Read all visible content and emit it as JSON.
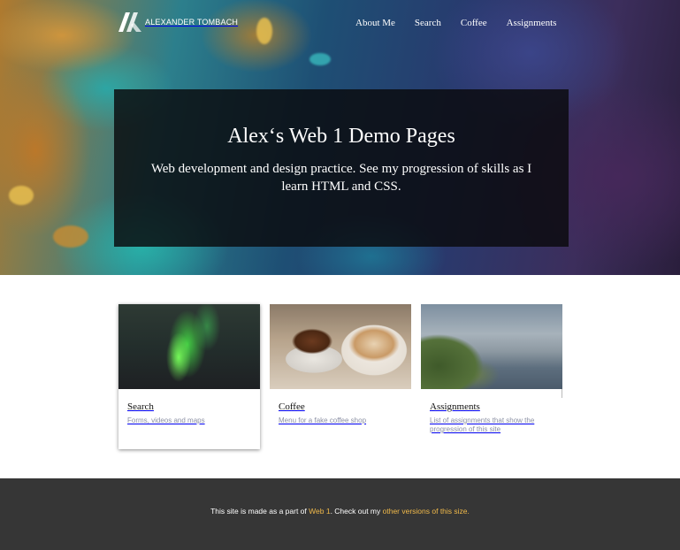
{
  "site": {
    "brand_name": "ALEXANDER TOMBACH",
    "logo_icon": "ak-monogram-icon"
  },
  "nav": {
    "items": [
      {
        "label": "About Me"
      },
      {
        "label": "Search"
      },
      {
        "label": "Coffee"
      },
      {
        "label": "Assignments"
      }
    ]
  },
  "hero": {
    "title": "Alex‘s Web 1 Demo Pages",
    "subtitle": "Web development and design practice. See my progression of skills as I learn HTML and CSS."
  },
  "cards": [
    {
      "title": "Search",
      "description": "Forms, videos and maps",
      "image": "aurora-photo"
    },
    {
      "title": "Coffee",
      "description": "Menu for a fake coffee shop",
      "image": "coffee-cake-photo"
    },
    {
      "title": "Assignments",
      "description": "List of assignments that show the progression of this site",
      "image": "coastline-photo"
    }
  ],
  "footer": {
    "text_before": "This site is made as a part of ",
    "link1": "Web 1",
    "text_middle": ". Check out my ",
    "link2": "other versions of this size."
  },
  "colors": {
    "footer_bg": "#363636",
    "link_accent": "#f0b94a",
    "card_desc": "#8a8fa3"
  }
}
